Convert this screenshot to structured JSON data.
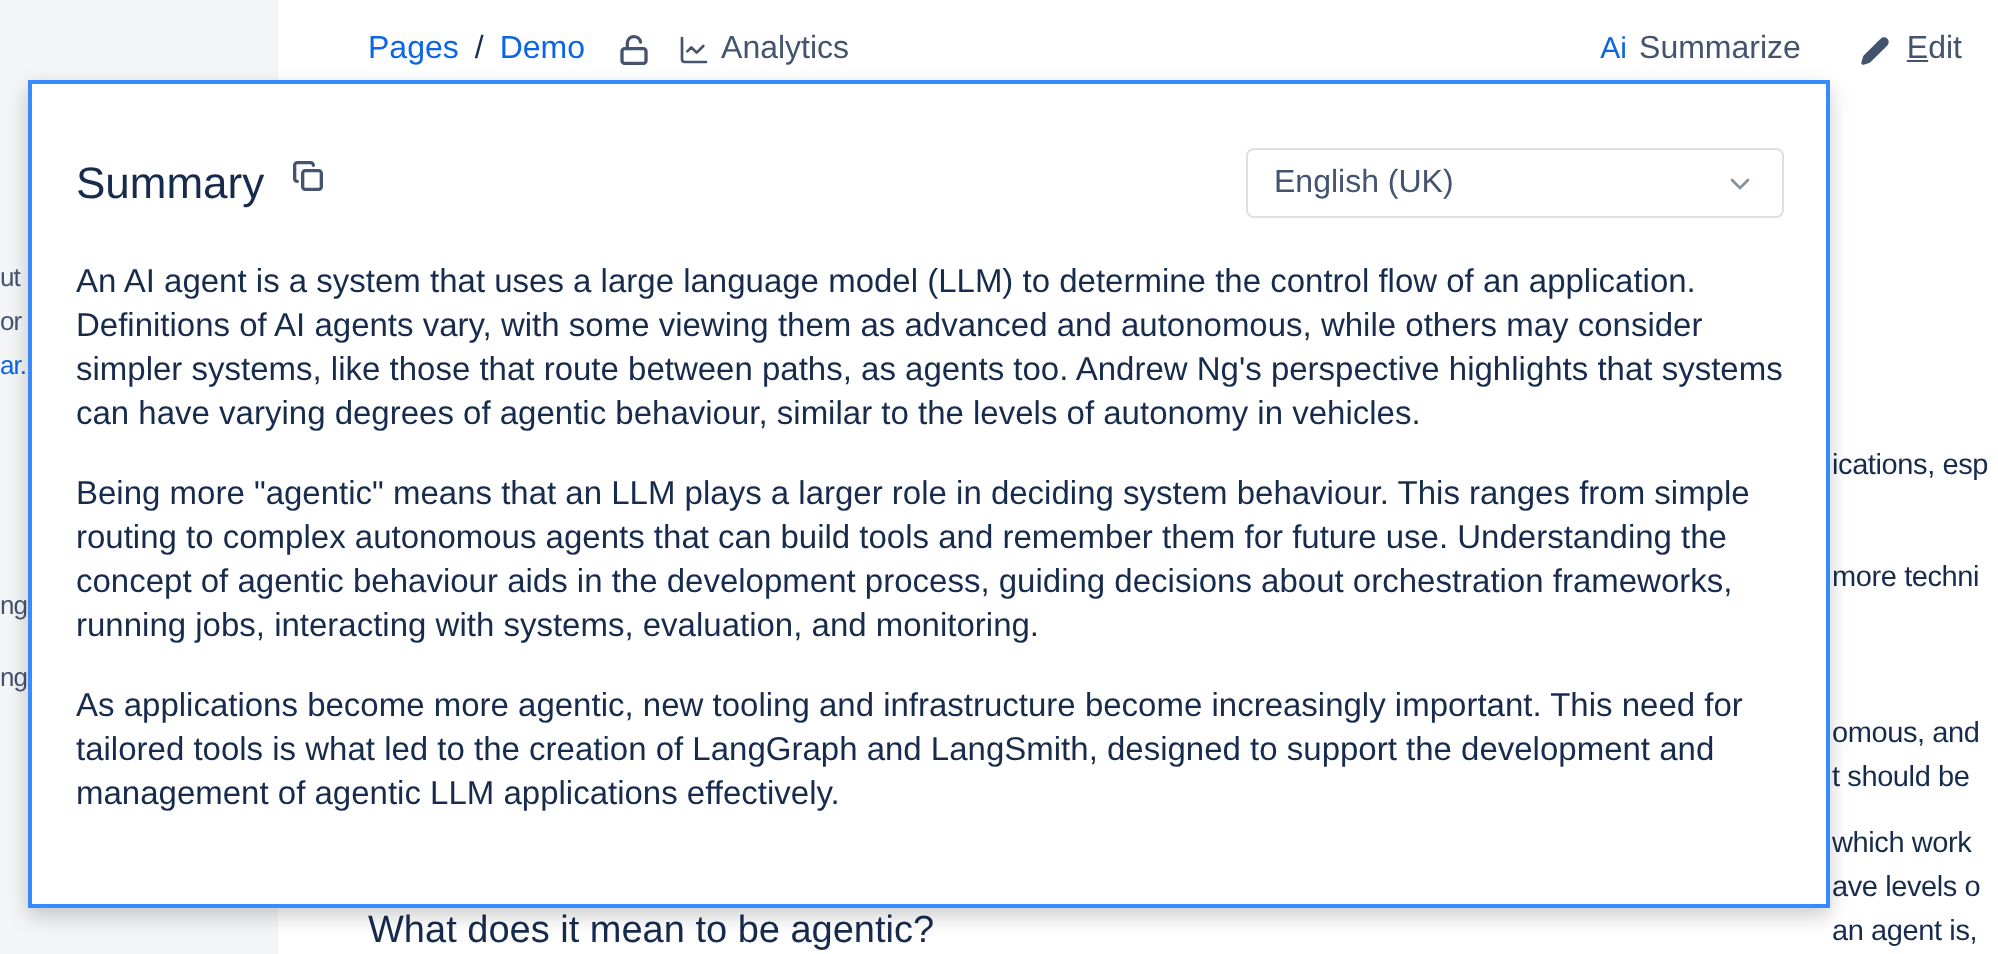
{
  "sidebar_fragments": [
    {
      "text": "ut",
      "kind": "text"
    },
    {
      "text": "or",
      "kind": "text"
    },
    {
      "text": "ar.",
      "kind": "link"
    },
    {
      "text": "ng",
      "kind": "text"
    },
    {
      "text": "ng",
      "kind": "text"
    }
  ],
  "breadcrumb": [
    "Pages",
    "Demo"
  ],
  "breadcrumb_separator": "/",
  "analytics": {
    "label": "Analytics"
  },
  "actions": [
    {
      "kind": "summarize",
      "icon_text": "Ai",
      "label": "Summarize"
    },
    {
      "kind": "edit",
      "label": "Edit"
    }
  ],
  "page_fragments": [
    "ications, esp",
    "more techni",
    "omous, and",
    "t should be",
    "which work",
    "ave levels o",
    "an agent is,"
  ],
  "heading": "What does it mean to be agentic?",
  "summary": {
    "title": "Summary",
    "language": "English (UK)",
    "paragraphs": [
      "An AI agent is a system that uses a large language model (LLM) to determine the control flow of an application. Definitions of AI agents vary, with some viewing them as advanced and autonomous, while others may consider simpler systems, like those that route between paths, as agents too. Andrew Ng's perspective highlights that systems can have varying degrees of agentic behaviour, similar to the levels of autonomy in vehicles.",
      "Being more \"agentic\" means that an LLM plays a larger role in deciding system behaviour. This ranges from simple routing to complex autonomous agents that can build tools and remember them for future use. Understanding the concept of agentic behaviour aids in the development process, guiding decisions about orchestration frameworks, running jobs, interacting with systems, evaluation, and monitoring.",
      "As applications become more agentic, new tooling and infrastructure become increasingly important. This need for tailored tools is what led to the creation of LangGraph and LangSmith, designed to support the development and management of agentic LLM applications effectively."
    ]
  }
}
